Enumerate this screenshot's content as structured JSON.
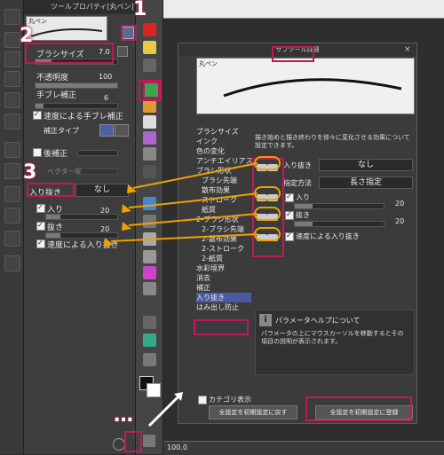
{
  "tool_property": {
    "header": "ツールプロパティ[丸ペン]",
    "tab_label": "丸ペン",
    "brush_size_label": "ブラシサイズ",
    "brush_size_value": "7.0",
    "opacity_label": "不透明度",
    "opacity_value": "100",
    "hand_correction_label": "手ブレ補正",
    "hand_correction_value": "6",
    "speed_correction_label": "速度による手ブレ補正",
    "correction_type_label": "補正タイプ",
    "post_correction_label": "後補正",
    "vector_label": "ベクター吸",
    "taper_label": "入り抜き",
    "taper_value": "なし",
    "taper_in_label": "入り",
    "taper_in_value": "20",
    "taper_out_label": "抜き",
    "taper_out_value": "20",
    "taper_speed_label": "速度による入り抜き"
  },
  "annotations": {
    "n1": "1",
    "n2": "2",
    "n3": "3",
    "dots": "…"
  },
  "dialog": {
    "title": "サブツール詳細",
    "preview_label": "丸ペン",
    "description": "描き始めと描き終わりを徐々に変化させる効果について設定できます。",
    "categories": [
      "ブラシサイズ",
      "インク",
      "色の変化",
      "アンチエイリアス",
      "ブラシ形状",
      "ブラシ先端",
      "散布効果",
      "ストローク",
      "紙質",
      "2-ブラシ形状",
      "2-ブラシ先端",
      "2-散布効果",
      "2-ストローク",
      "2-紙質",
      "水彩境界",
      "消去",
      "補正",
      "入り抜き",
      "はみ出し防止"
    ],
    "props": {
      "taper_label": "入り抜き",
      "taper_value": "なし",
      "method_label": "指定方法",
      "method_value": "長さ指定",
      "in_label": "入り",
      "in_value": "20",
      "out_label": "抜き",
      "out_value": "20",
      "speed_label": "速度による入り抜き"
    },
    "help_title": "パラメータヘルプについて",
    "help_text": "パラメータの上にマウスカーソルを移動するとその項目の説明が表示されます。",
    "show_category_label": "カテゴリ表示",
    "reset_all_button": "全設定を初期設定に戻す",
    "register_all_button": "全設定を初期設定に登録"
  },
  "bottom": {
    "zoom": "100.0"
  }
}
